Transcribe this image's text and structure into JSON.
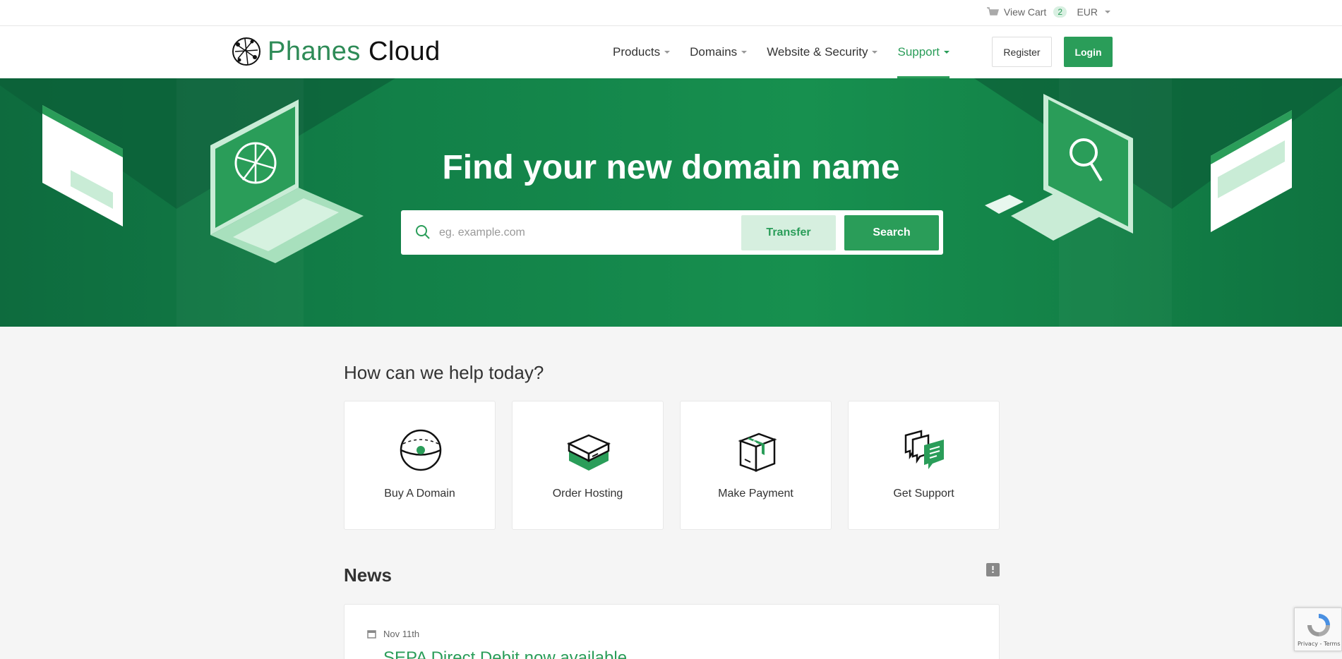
{
  "topbar": {
    "cart_label": "View Cart",
    "cart_count": "2",
    "currency": "EUR"
  },
  "header": {
    "logo_word_1": "Phanes",
    "logo_word_2": "Cloud",
    "nav": [
      {
        "label": "Products"
      },
      {
        "label": "Domains"
      },
      {
        "label": "Website & Security"
      },
      {
        "label": "Support"
      }
    ],
    "register_label": "Register",
    "login_label": "Login"
  },
  "hero": {
    "title": "Find your new domain name",
    "search_placeholder": "eg. example.com",
    "transfer_label": "Transfer",
    "search_label": "Search"
  },
  "help": {
    "title": "How can we help today?",
    "cards": [
      {
        "label": "Buy A Domain",
        "icon": "globe-icon"
      },
      {
        "label": "Order Hosting",
        "icon": "server-icon"
      },
      {
        "label": "Make Payment",
        "icon": "package-icon"
      },
      {
        "label": "Get Support",
        "icon": "chat-icon"
      }
    ]
  },
  "news": {
    "title": "News",
    "items": [
      {
        "date": "Nov 11th",
        "headline": "SEPA Direct Debit now available"
      }
    ]
  },
  "recaptcha": {
    "text": "Privacy - Terms"
  },
  "colors": {
    "brand": "#2a9d59",
    "hero_bg": "#128048"
  }
}
